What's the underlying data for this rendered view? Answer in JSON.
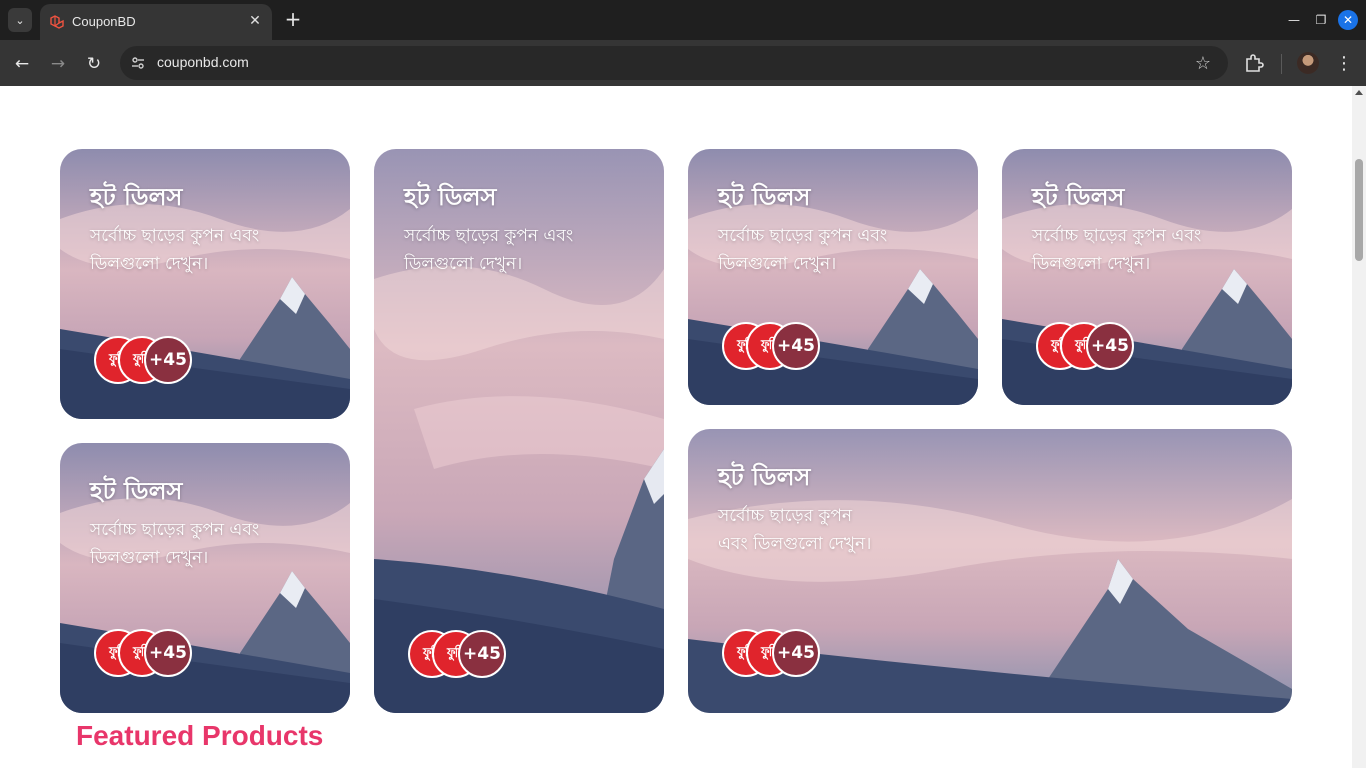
{
  "browser": {
    "tab_title": "CouponBD",
    "url": "couponbd.com",
    "icons": {
      "tab_list": "chevron-down-icon",
      "favicon": "laravel-logo-icon",
      "close_tab": "close-icon",
      "new_tab": "plus-icon",
      "back": "arrow-left-icon",
      "forward": "arrow-right-icon",
      "reload": "reload-icon",
      "site_info": "tune-icon",
      "bookmark": "star-icon",
      "extensions": "puzzle-icon",
      "menu": "kebab-icon"
    },
    "symbols": {
      "chevron": "⌄",
      "close": "✕",
      "plus": "+",
      "back": "←",
      "forward": "→",
      "reload": "↻",
      "site_info": "⚙",
      "star": "☆",
      "menu": "⋮",
      "minimize": "—",
      "maximize": "❐",
      "window_close": "✕"
    }
  },
  "deals": [
    {
      "title": "হট ডিলস",
      "description": "সর্বোচ্চ ছাড়ের কুপন এবং ডিলগুলো দেখুন।",
      "avatar_labels": [
        "ফুডি",
        "ফুডি"
      ],
      "more_count": "+45"
    },
    {
      "title": "হট ডিলস",
      "description": "সর্বোচ্চ ছাড়ের কুপন এবং ডিলগুলো দেখুন।",
      "avatar_labels": [
        "ফুডি",
        "ফুডি"
      ],
      "more_count": "+45"
    },
    {
      "title": "হট ডিলস",
      "description": "সর্বোচ্চ ছাড়ের কুপন এবং ডিলগুলো দেখুন।",
      "avatar_labels": [
        "ফুডি",
        "ফুডি"
      ],
      "more_count": "+45"
    },
    {
      "title": "হট ডিলস",
      "description": "সর্বোচ্চ ছাড়ের কুপন এবং ডিলগুলো দেখুন।",
      "avatar_labels": [
        "ফুডি",
        "ফুডি"
      ],
      "more_count": "+45"
    },
    {
      "title": "হট ডিলস",
      "description": "সর্বোচ্চ ছাড়ের কুপন এবং ডিলগুলো দেখুন।",
      "avatar_labels": [
        "ফুডি",
        "ফুডি"
      ],
      "more_count": "+45"
    },
    {
      "title": "হট ডিলস",
      "description": "সর্বোচ্চ ছাড়ের কুপন এবং ডিলগুলো দেখুন।",
      "avatar_labels": [
        "ফুডি",
        "ফুডি"
      ],
      "more_count": "+45"
    }
  ],
  "section": {
    "featured_title": "Featured Products"
  },
  "colors": {
    "accent": "#e8366a",
    "avatar_red": "#e0242c"
  }
}
